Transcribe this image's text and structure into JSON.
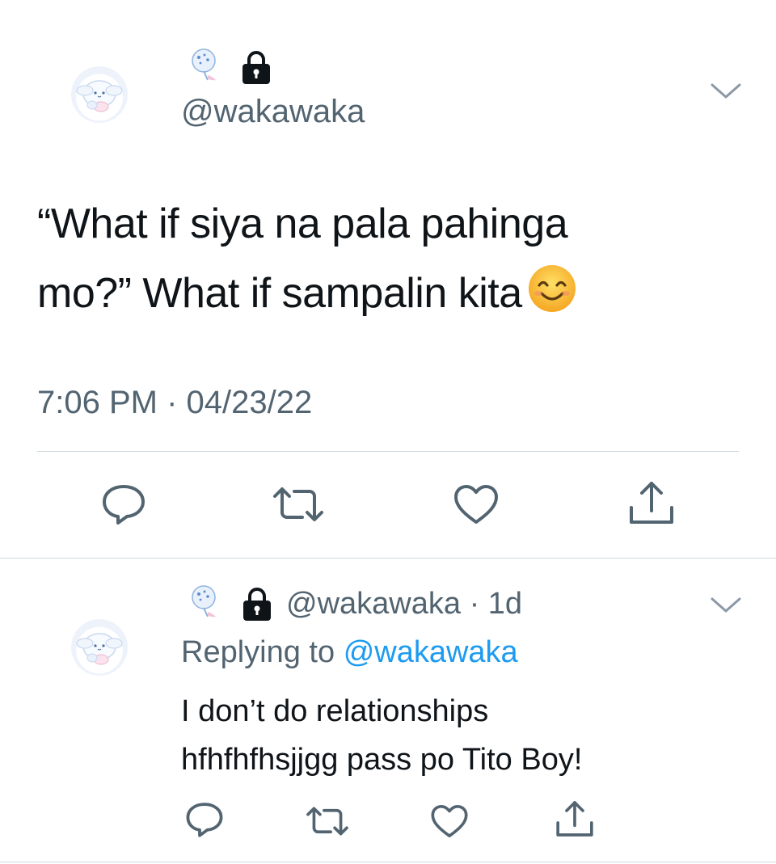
{
  "tweet": {
    "handle": "@wakawaka",
    "text_line1": "“What if siya na pala pahinga",
    "text_line2": "mo?” What if sampalin kita",
    "emoji": "smiling-face-with-smiling-eyes",
    "time": "7:06 PM",
    "separator": "·",
    "date": "04/23/22"
  },
  "reply": {
    "handle": "@wakawaka",
    "separator": "·",
    "age": "1d",
    "replying_prefix": "Replying to",
    "replying_handle": "@wakawaka",
    "text_line1": "I don’t do relationships",
    "text_line2": "hfhfhfhsjjgg pass po Tito Boy!"
  },
  "icons": {
    "reply": "reply-icon",
    "retweet": "retweet-icon",
    "like": "heart-icon",
    "share": "share-icon",
    "more": "chevron-down-icon",
    "protected": "lock-icon"
  },
  "colors": {
    "text": "#0f1419",
    "secondary": "#536471",
    "link": "#1d9bf0",
    "divider": "#cfd9de"
  }
}
